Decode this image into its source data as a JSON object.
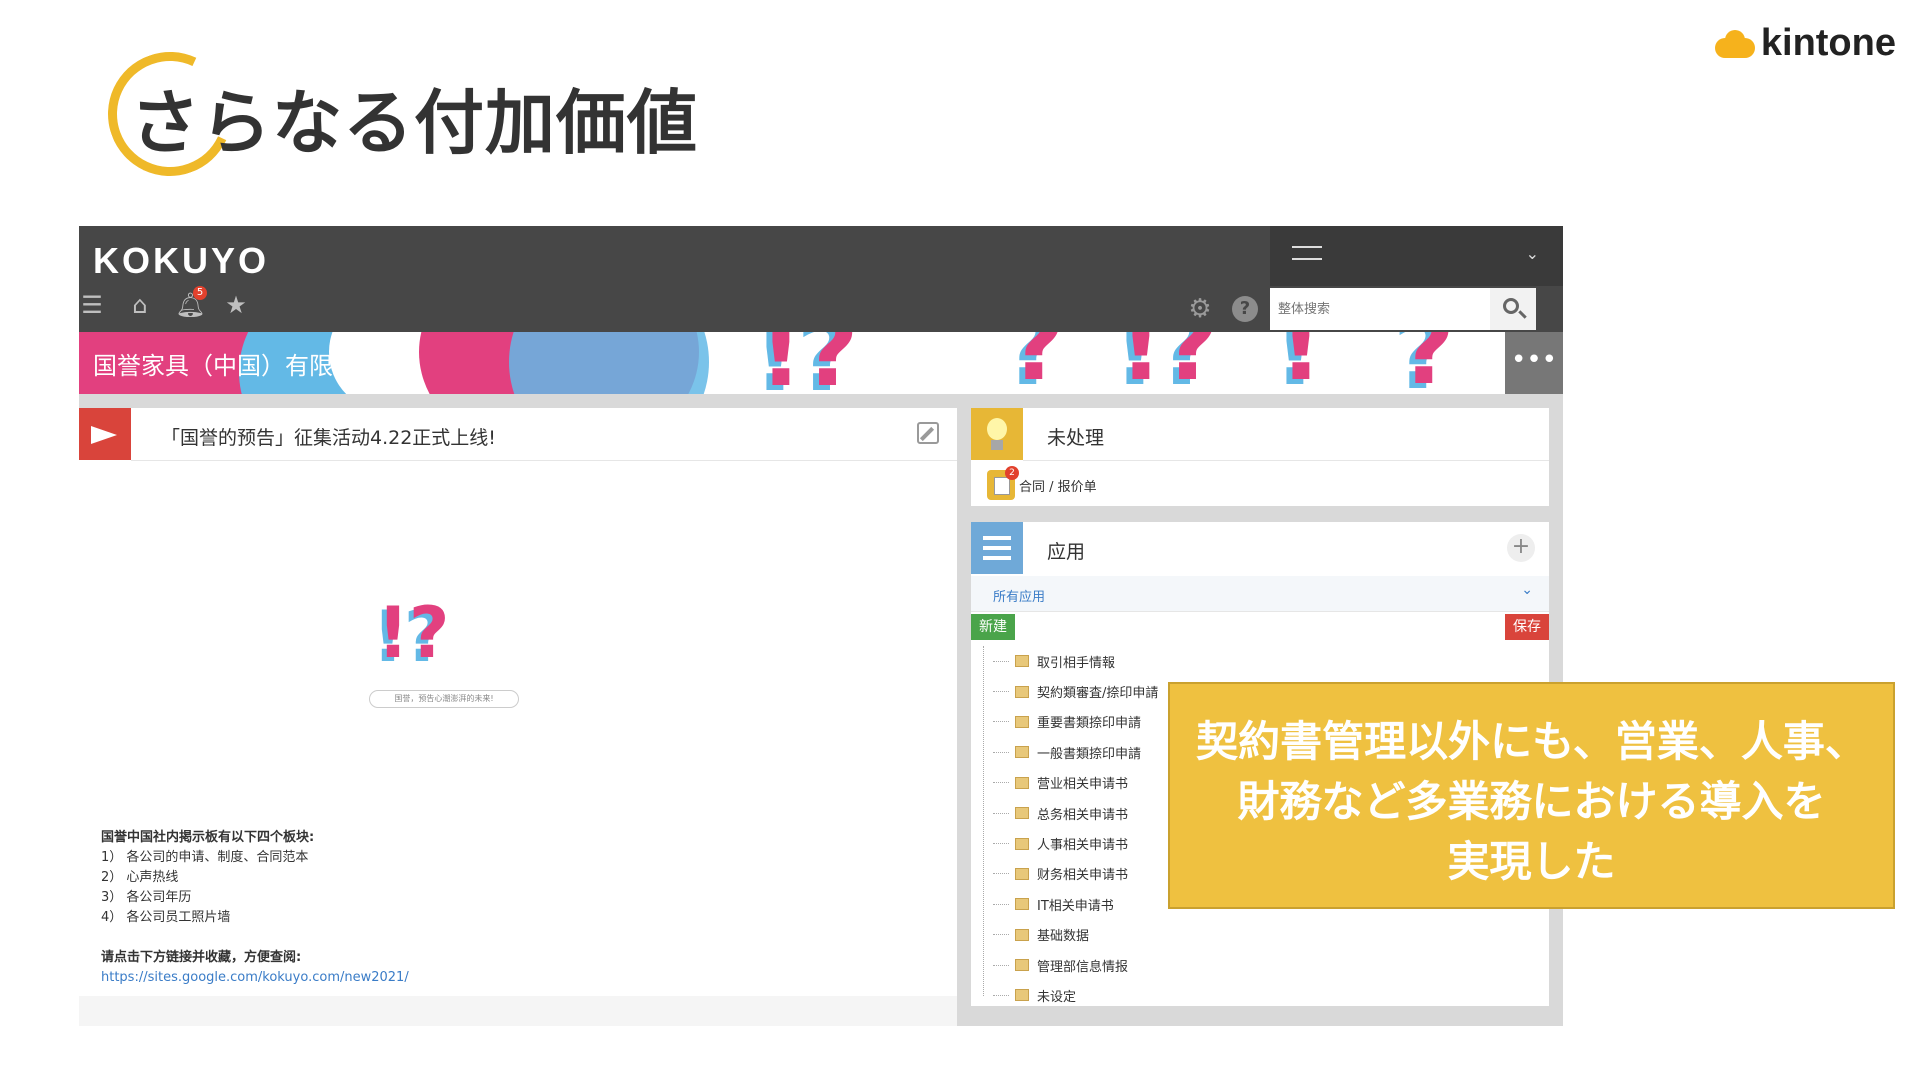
{
  "slide": {
    "title": "さらなる付加価値",
    "brand": "kintone"
  },
  "header": {
    "logo": "KOKUYO",
    "notification_count": "5",
    "search_placeholder": "整体搜索"
  },
  "banner": {
    "company_name": "国誉家具（中国）有限公司",
    "more_label": "•••"
  },
  "announcement": {
    "title": "「国誉的预告」征集活动4.22正式上线!",
    "illustration_mark": "!?",
    "illustration_caption": "国誉，预告心潮澎湃的未来!",
    "intro_heading": "国誉中国社内掲示板有以下四个板块:",
    "intro_items": [
      "1）  各公司的申请、制度、合同范本",
      "2）  心声热线",
      "3）  各公司年历",
      "4）  各公司员工照片墙"
    ],
    "bookmark_note": "请点击下方链接并收藏，方便查阅:",
    "link": "https://sites.google.com/kokuyo.com/new2021/"
  },
  "pending": {
    "title": "未处理",
    "item_label": "合同 / 报价单",
    "item_count": "2"
  },
  "apps": {
    "title": "应用",
    "filter_label": "所有应用",
    "new_label": "新建",
    "save_label": "保存",
    "items": [
      "取引相手情報",
      "契約類審査/捺印申請",
      "重要書類捺印申請",
      "一般書類捺印申請",
      "营业相关申请书",
      "总务相关申请书",
      "人事相关申请书",
      "财务相关申请书",
      "IT相关申请书",
      "基础数据",
      "管理部信息情报",
      "未设定"
    ]
  },
  "callout": {
    "lines": [
      "契約書管理以外にも、営業、人事、",
      "財務など多業務における導入を",
      "実現した"
    ]
  }
}
